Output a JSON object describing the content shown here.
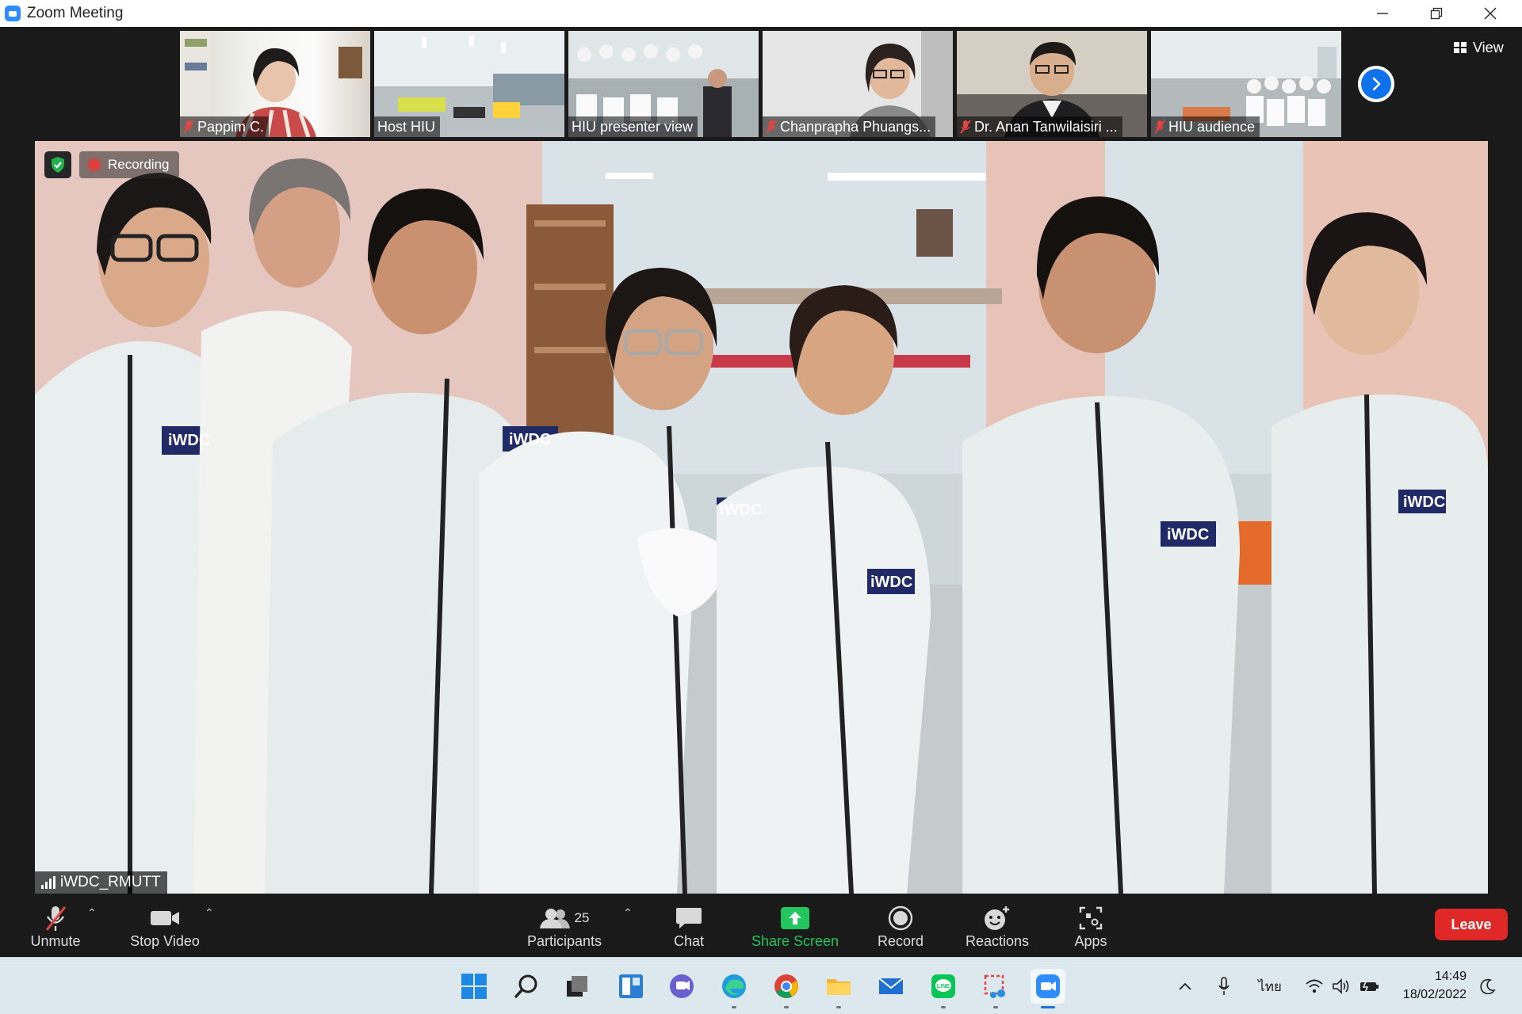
{
  "window": {
    "title": "Zoom Meeting"
  },
  "gallery": {
    "participants": [
      {
        "name": "Pappim C.",
        "muted": true
      },
      {
        "name": "Host HIU",
        "muted": false
      },
      {
        "name": "HIU presenter view",
        "muted": false
      },
      {
        "name": "Chanprapha Phuangs...",
        "muted": true
      },
      {
        "name": "Dr. Anan Tanwilaisiri ...",
        "muted": true
      },
      {
        "name": "HIU audience",
        "muted": true
      }
    ],
    "view_label": "View"
  },
  "main_video": {
    "recording_label": "Recording",
    "speaker_name": "iWDC_RMUTT",
    "jacket_logo": "iWDC"
  },
  "toolbar": {
    "unmute": "Unmute",
    "stop_video": "Stop Video",
    "participants": "Participants",
    "participants_count": "25",
    "chat": "Chat",
    "share_screen": "Share Screen",
    "record": "Record",
    "reactions": "Reactions",
    "apps": "Apps",
    "leave": "Leave"
  },
  "taskbar": {
    "language": "ไทย",
    "time": "14:49",
    "date": "18/02/2022"
  },
  "colors": {
    "zoom_blue": "#2d8cff",
    "share_green": "#22c55e",
    "leave_red": "#e02828",
    "recording_red": "#e0403c"
  }
}
